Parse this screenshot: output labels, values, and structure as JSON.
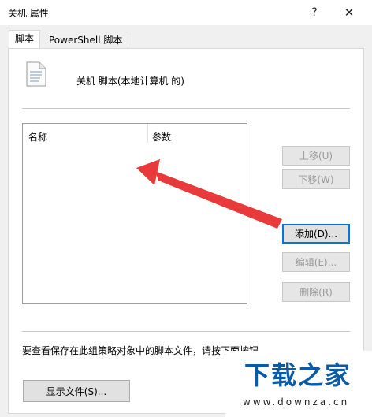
{
  "window": {
    "title": "关机 属性",
    "help_glyph": "?",
    "close_glyph": "✕"
  },
  "tabs": [
    {
      "label": "脚本",
      "active": true
    },
    {
      "label": "PowerShell 脚本",
      "active": false
    }
  ],
  "header": {
    "text": "关机 脚本(本地计算机 的)",
    "icon": "script-file-icon"
  },
  "list": {
    "columns": [
      "名称",
      "参数"
    ],
    "rows": []
  },
  "buttons": {
    "up": {
      "label": "上移(U)",
      "enabled": false
    },
    "down": {
      "label": "下移(W)",
      "enabled": false
    },
    "add": {
      "label": "添加(D)...",
      "enabled": true
    },
    "edit": {
      "label": "编辑(E)...",
      "enabled": false
    },
    "remove": {
      "label": "删除(R)",
      "enabled": false
    },
    "show_files": {
      "label": "显示文件(S)..."
    }
  },
  "info_text": "要查看保存在此组策略对象中的脚本文件，请按下面按钮",
  "annotation": {
    "arrow_color": "#e83a3a"
  },
  "watermark": {
    "main": "下载之家",
    "sub": "www.downza.cn"
  }
}
